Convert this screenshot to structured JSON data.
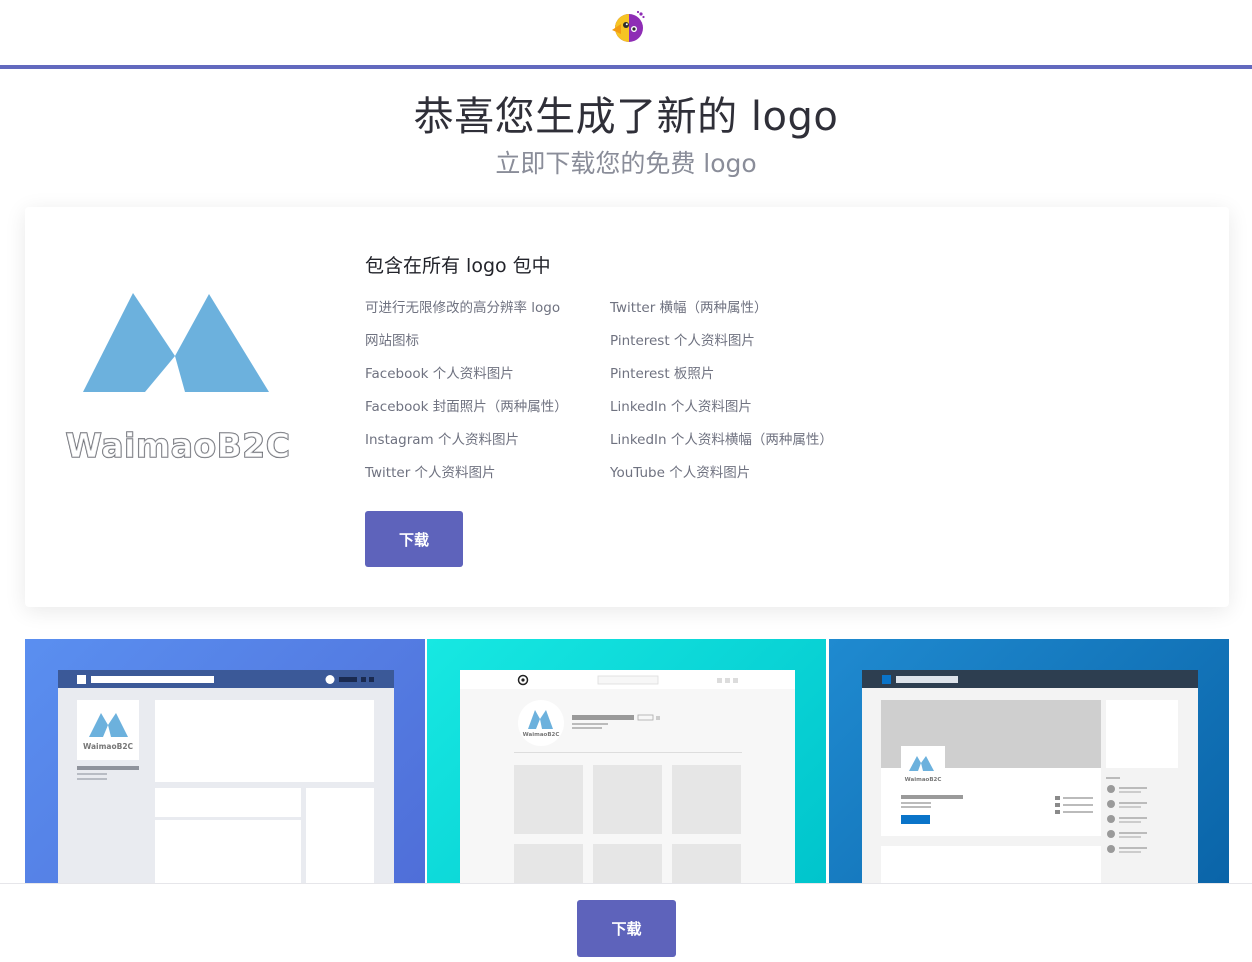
{
  "header": {
    "brand_icon": "parrot-logo-icon",
    "accent": "#6269be"
  },
  "hero": {
    "title": "恭喜您生成了新的 logo",
    "subtitle": "立即下载您的免费 logo"
  },
  "package": {
    "heading": "包含在所有 logo 包中",
    "logo_text": "WaimaoB2C",
    "logo_color": "#6cb1dd",
    "features_left": [
      "可进行无限修改的高分辨率 logo",
      "网站图标",
      "Facebook 个人资料图片",
      "Facebook 封面照片（两种属性）",
      "Instagram 个人资料图片",
      "Twitter 个人资料图片"
    ],
    "features_right": [
      "Twitter 横幅（两种属性）",
      "Pinterest 个人资料图片",
      "Pinterest 板照片",
      "LinkedIn 个人资料图片",
      "LinkedIn 个人资料横幅（两种属性）",
      "YouTube 个人资料图片"
    ],
    "download_label": "下载"
  },
  "previews": {
    "facebook_logo_text": "WaimaoB2C",
    "instagram_logo_text": "WaimaoB2C",
    "linkedin_logo_text": "WaimaoB2C",
    "colors": {
      "facebook": "#4f6ed8",
      "instagram": "#00d8d8",
      "linkedin": "#0a64a8"
    }
  },
  "footer": {
    "download_label": "下载",
    "button_color": "#5e63bb"
  }
}
